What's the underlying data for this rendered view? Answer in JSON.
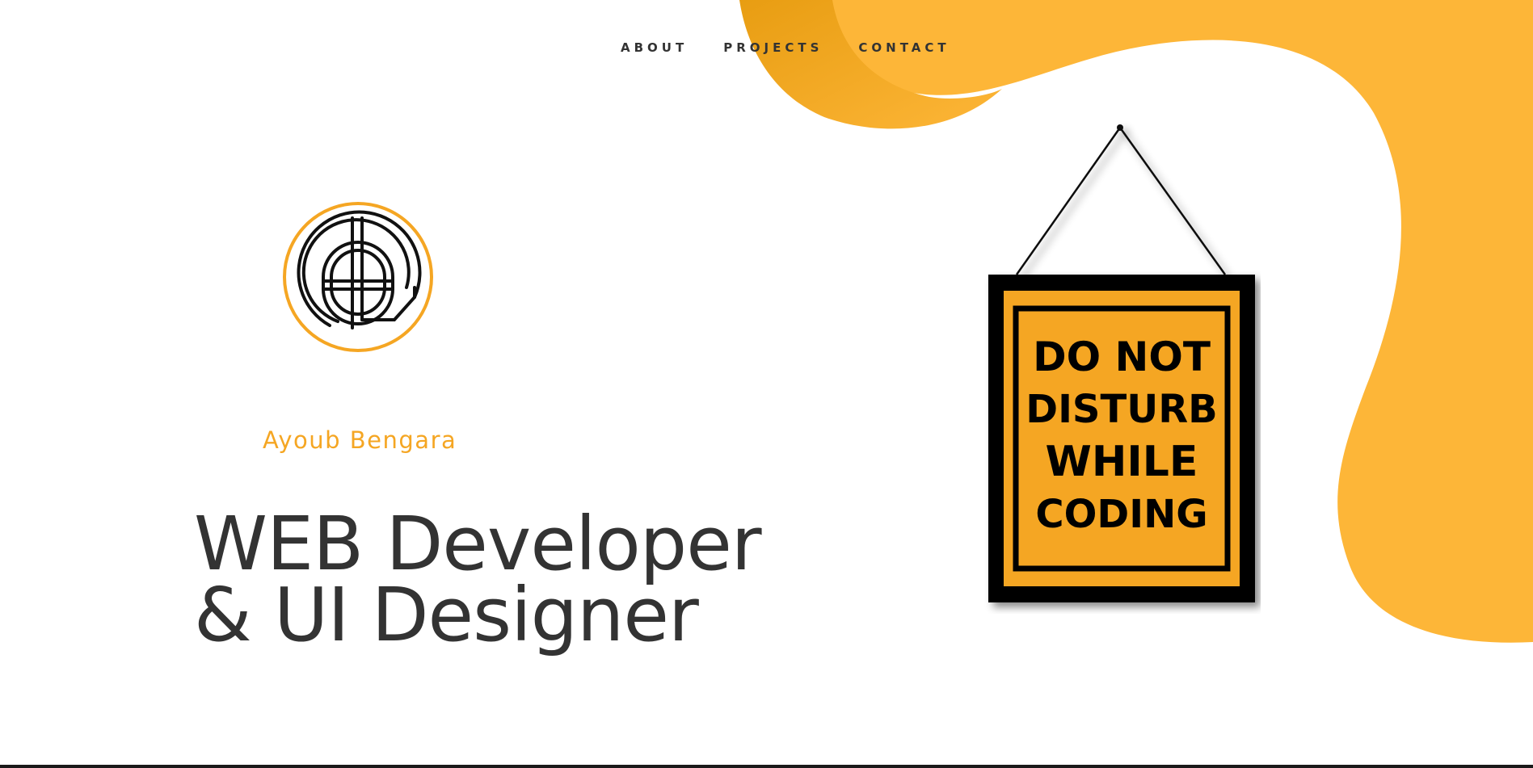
{
  "colors": {
    "accent": "#f5a623",
    "blob": "#fdb638",
    "text": "#333333",
    "background": "#ffffff"
  },
  "nav": {
    "items": [
      {
        "label": "ABOUT"
      },
      {
        "label": "PROJECTS"
      },
      {
        "label": "CONTACT"
      }
    ]
  },
  "hero": {
    "name": "Ayoub Bengara",
    "headline_line1": "WEB Developer",
    "headline_line2": "& UI Designer"
  },
  "sign": {
    "line1": "DO NOT",
    "line2": "DISTURB",
    "line3": "WHILE",
    "line4": "CODING"
  },
  "logo": {
    "icon": "ab-monogram-logo"
  }
}
